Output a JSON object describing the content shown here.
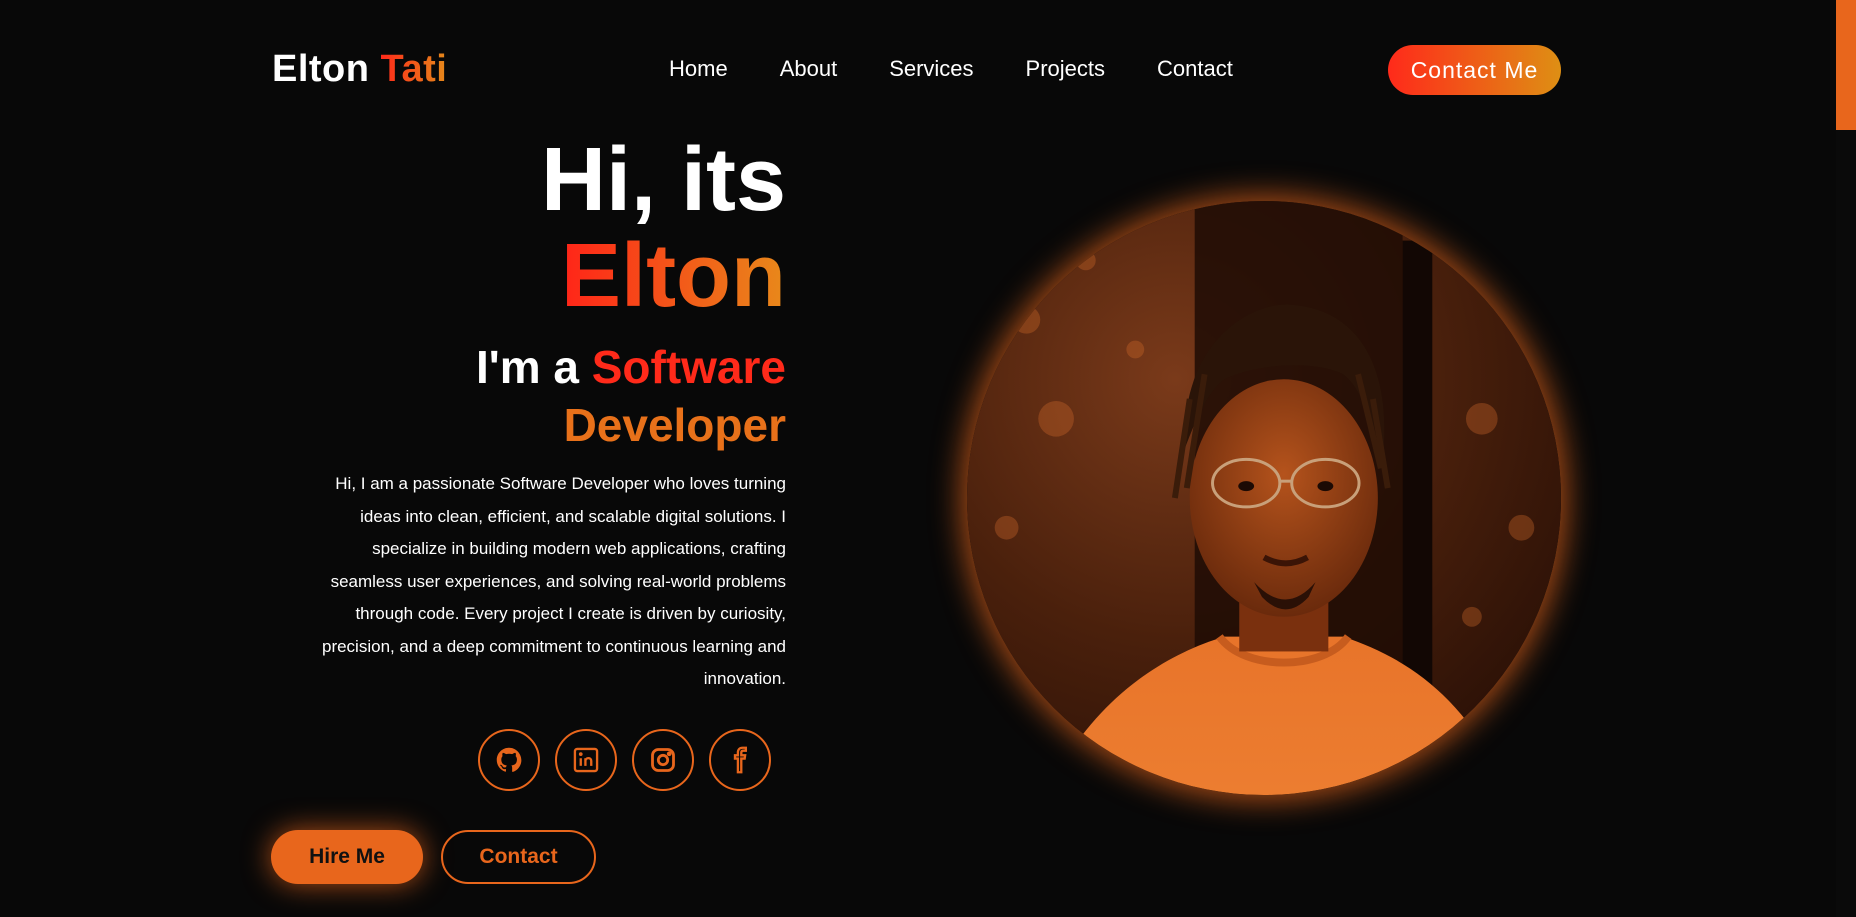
{
  "header": {
    "logo_first": "Elton",
    "logo_last": "Tati",
    "nav": [
      "Home",
      "About",
      "Services",
      "Projects",
      "Contact"
    ],
    "cta_label": "Contact Me"
  },
  "hero": {
    "greeting": "Hi, its",
    "name": "Elton",
    "role_prefix": "I'm a",
    "role_word1": "Software",
    "role_word2": "Developer",
    "bio": "Hi, I am a passionate Software Developer who loves turning ideas into clean, efficient, and scalable digital solutions. I specialize in building modern web applications, crafting seamless user experiences, and solving real-world problems through code. Every project I create is driven by curiosity, precision, and a deep commitment to continuous learning and innovation.",
    "hire_label": "Hire Me",
    "contact_label": "Contact"
  },
  "socials": [
    "github-icon",
    "linkedin-icon",
    "instagram-icon",
    "facebook-icon"
  ],
  "colors": {
    "accent": "#e8661c",
    "gradient_start": "#ff2a1a",
    "gradient_end": "#de8f14",
    "background": "#080808"
  }
}
